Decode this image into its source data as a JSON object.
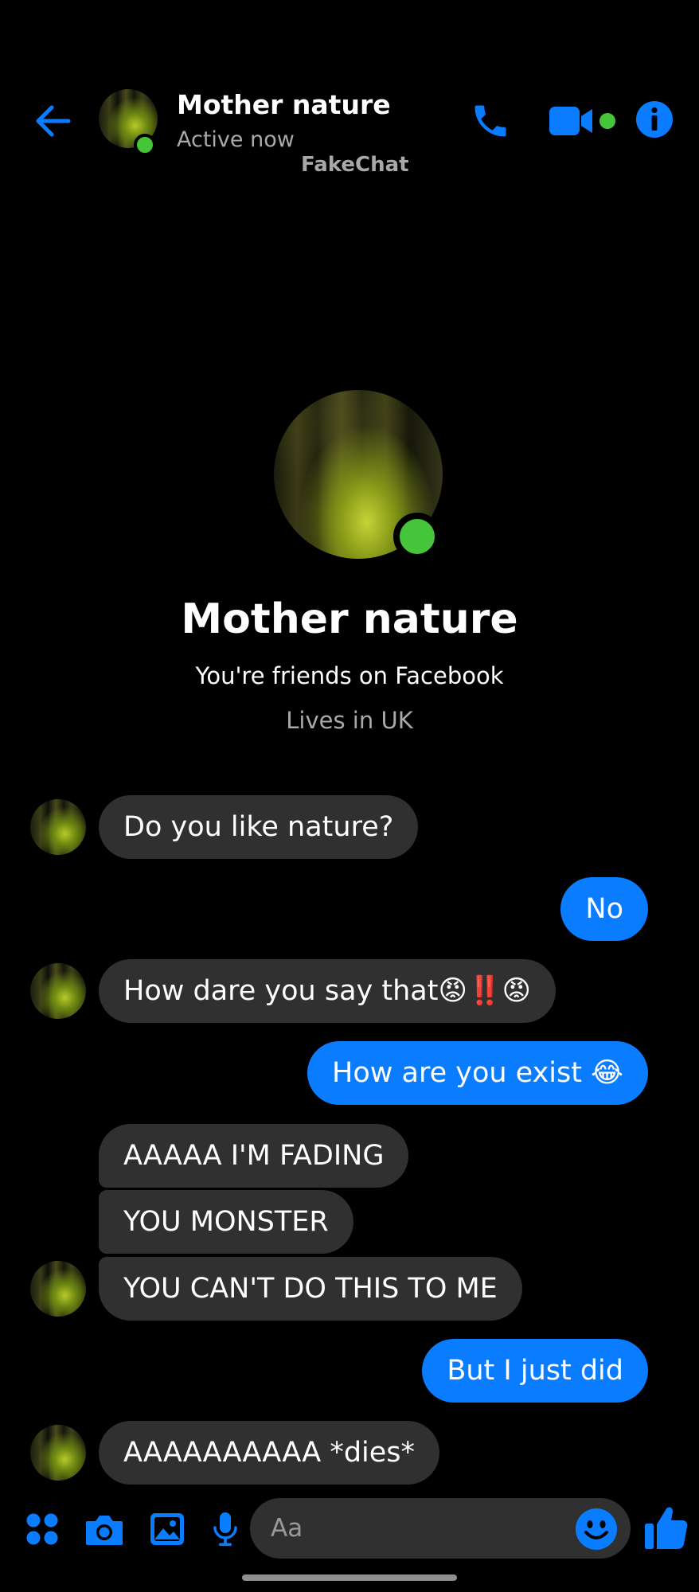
{
  "header": {
    "contact_name": "Mother nature",
    "status": "Active now",
    "watermark": "FakeChat"
  },
  "icons": {
    "back": "arrow-left-icon",
    "call": "phone-icon",
    "video": "video-camera-icon",
    "info": "info-icon",
    "apps": "apps-grid-icon",
    "camera": "camera-icon",
    "gallery": "image-icon",
    "mic": "microphone-icon",
    "emoji": "smiley-icon",
    "like": "thumbs-up-icon"
  },
  "profile": {
    "name": "Mother nature",
    "friends": "You're friends on Facebook",
    "location": "Lives in UK"
  },
  "messages": [
    {
      "side": "in",
      "text": "Do you like nature?"
    },
    {
      "side": "out",
      "text": "No"
    },
    {
      "side": "in",
      "text": "How dare you say that😡‼️😡"
    },
    {
      "side": "out",
      "text": "How are you exist 😂"
    },
    {
      "side": "in",
      "text": "AAAAA I'M FADING"
    },
    {
      "side": "in",
      "text": "YOU MONSTER"
    },
    {
      "side": "in",
      "text": "YOU CAN'T DO THIS TO ME"
    },
    {
      "side": "out",
      "text": "But I just did"
    },
    {
      "side": "in",
      "text": "AAAAAAAAAA *dies*"
    }
  ],
  "composer": {
    "placeholder": "Aa"
  },
  "colors": {
    "background": "#000000",
    "accent": "#0a7cff",
    "incoming_bubble": "#303030",
    "online": "#44c53a",
    "secondary_text": "#a9a9a9"
  }
}
